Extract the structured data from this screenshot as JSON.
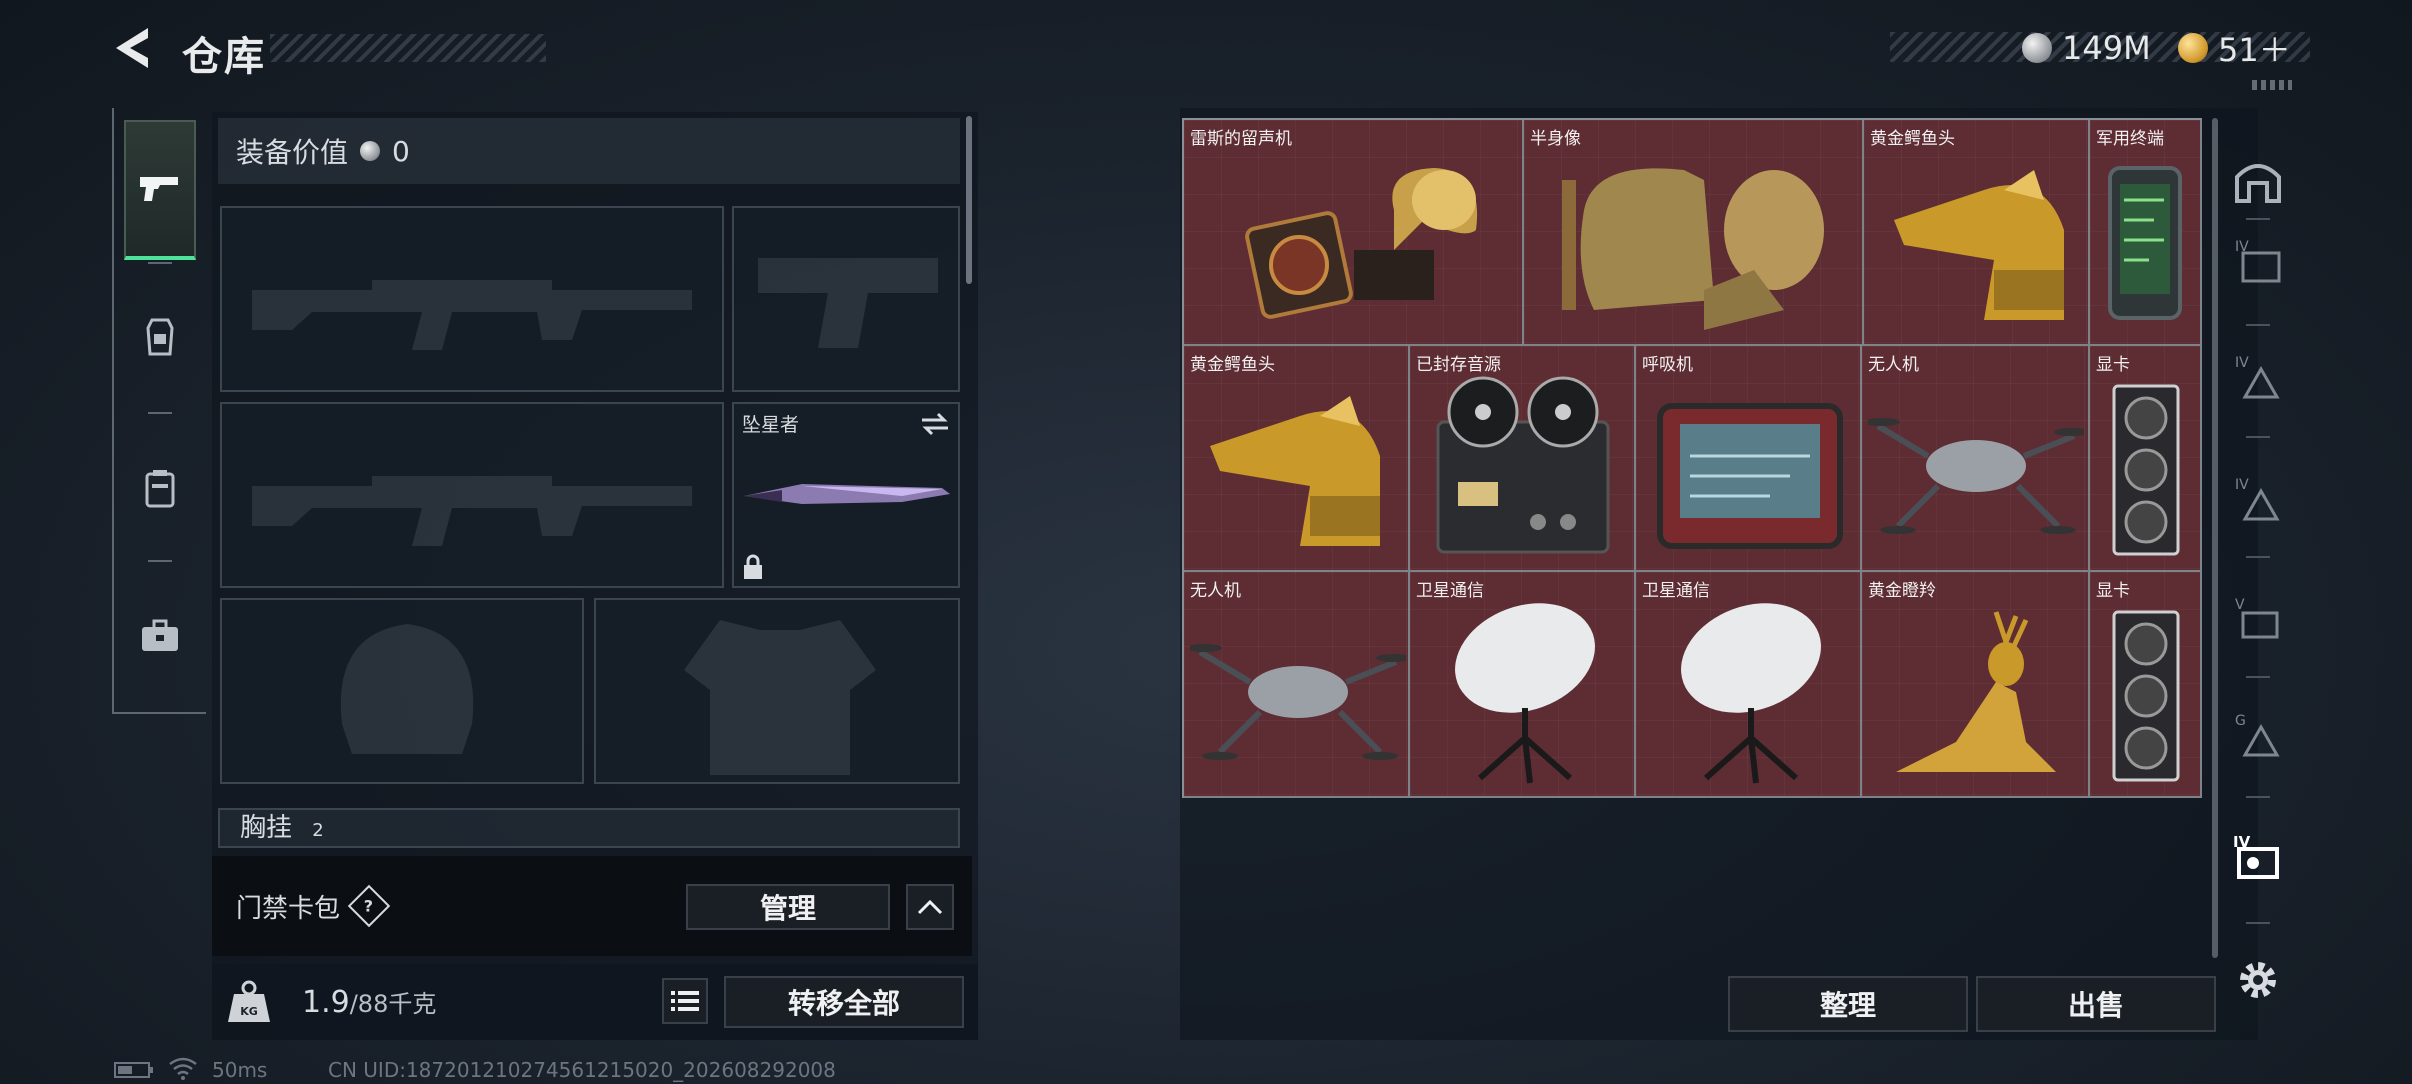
{
  "header": {
    "title": "仓库",
    "currency_silver": "149M",
    "currency_gold": "51＋"
  },
  "equipment": {
    "value_label": "装备价值",
    "value_amount": "0",
    "melee_name": "坠星者",
    "chest_label": "胸挂",
    "chest_count": "2"
  },
  "keycard": {
    "label": "门禁卡包",
    "help": "?",
    "manage_label": "管理"
  },
  "weight": {
    "icon_text": "KG",
    "current": "1.9",
    "max": "/88千克",
    "transfer_all_label": "转移全部"
  },
  "stash": {
    "items": [
      {
        "name": "雷斯的留声机",
        "icon": "gramophone-icon"
      },
      {
        "name": "半身像",
        "icon": "bust-icon"
      },
      {
        "name": "黄金鳄鱼头",
        "icon": "golden-crocodile-head-icon"
      },
      {
        "name": "军用终端",
        "icon": "military-terminal-icon"
      },
      {
        "name": "黄金鳄鱼头",
        "icon": "golden-crocodile-head-icon"
      },
      {
        "name": "已封存音源",
        "icon": "reel-tape-recorder-icon"
      },
      {
        "name": "呼吸机",
        "icon": "ventilator-icon"
      },
      {
        "name": "无人机",
        "icon": "drone-icon"
      },
      {
        "name": "显卡",
        "icon": "graphics-card-icon"
      },
      {
        "name": "无人机",
        "icon": "drone-icon"
      },
      {
        "name": "卫星通信",
        "icon": "satellite-dish-icon"
      },
      {
        "name": "卫星通信",
        "icon": "satellite-dish-icon"
      },
      {
        "name": "黄金瞪羚",
        "icon": "golden-gazelle-icon"
      },
      {
        "name": "显卡",
        "icon": "graphics-card-icon"
      }
    ],
    "sort_label": "整理",
    "sell_label": "出售"
  },
  "status_bar": {
    "ping": "50ms",
    "uid": "CN UID:18720121027456121502​0_202608292008"
  },
  "colors": {
    "accent_green": "#4ee39a",
    "grid_bg": "#5e2c33"
  }
}
